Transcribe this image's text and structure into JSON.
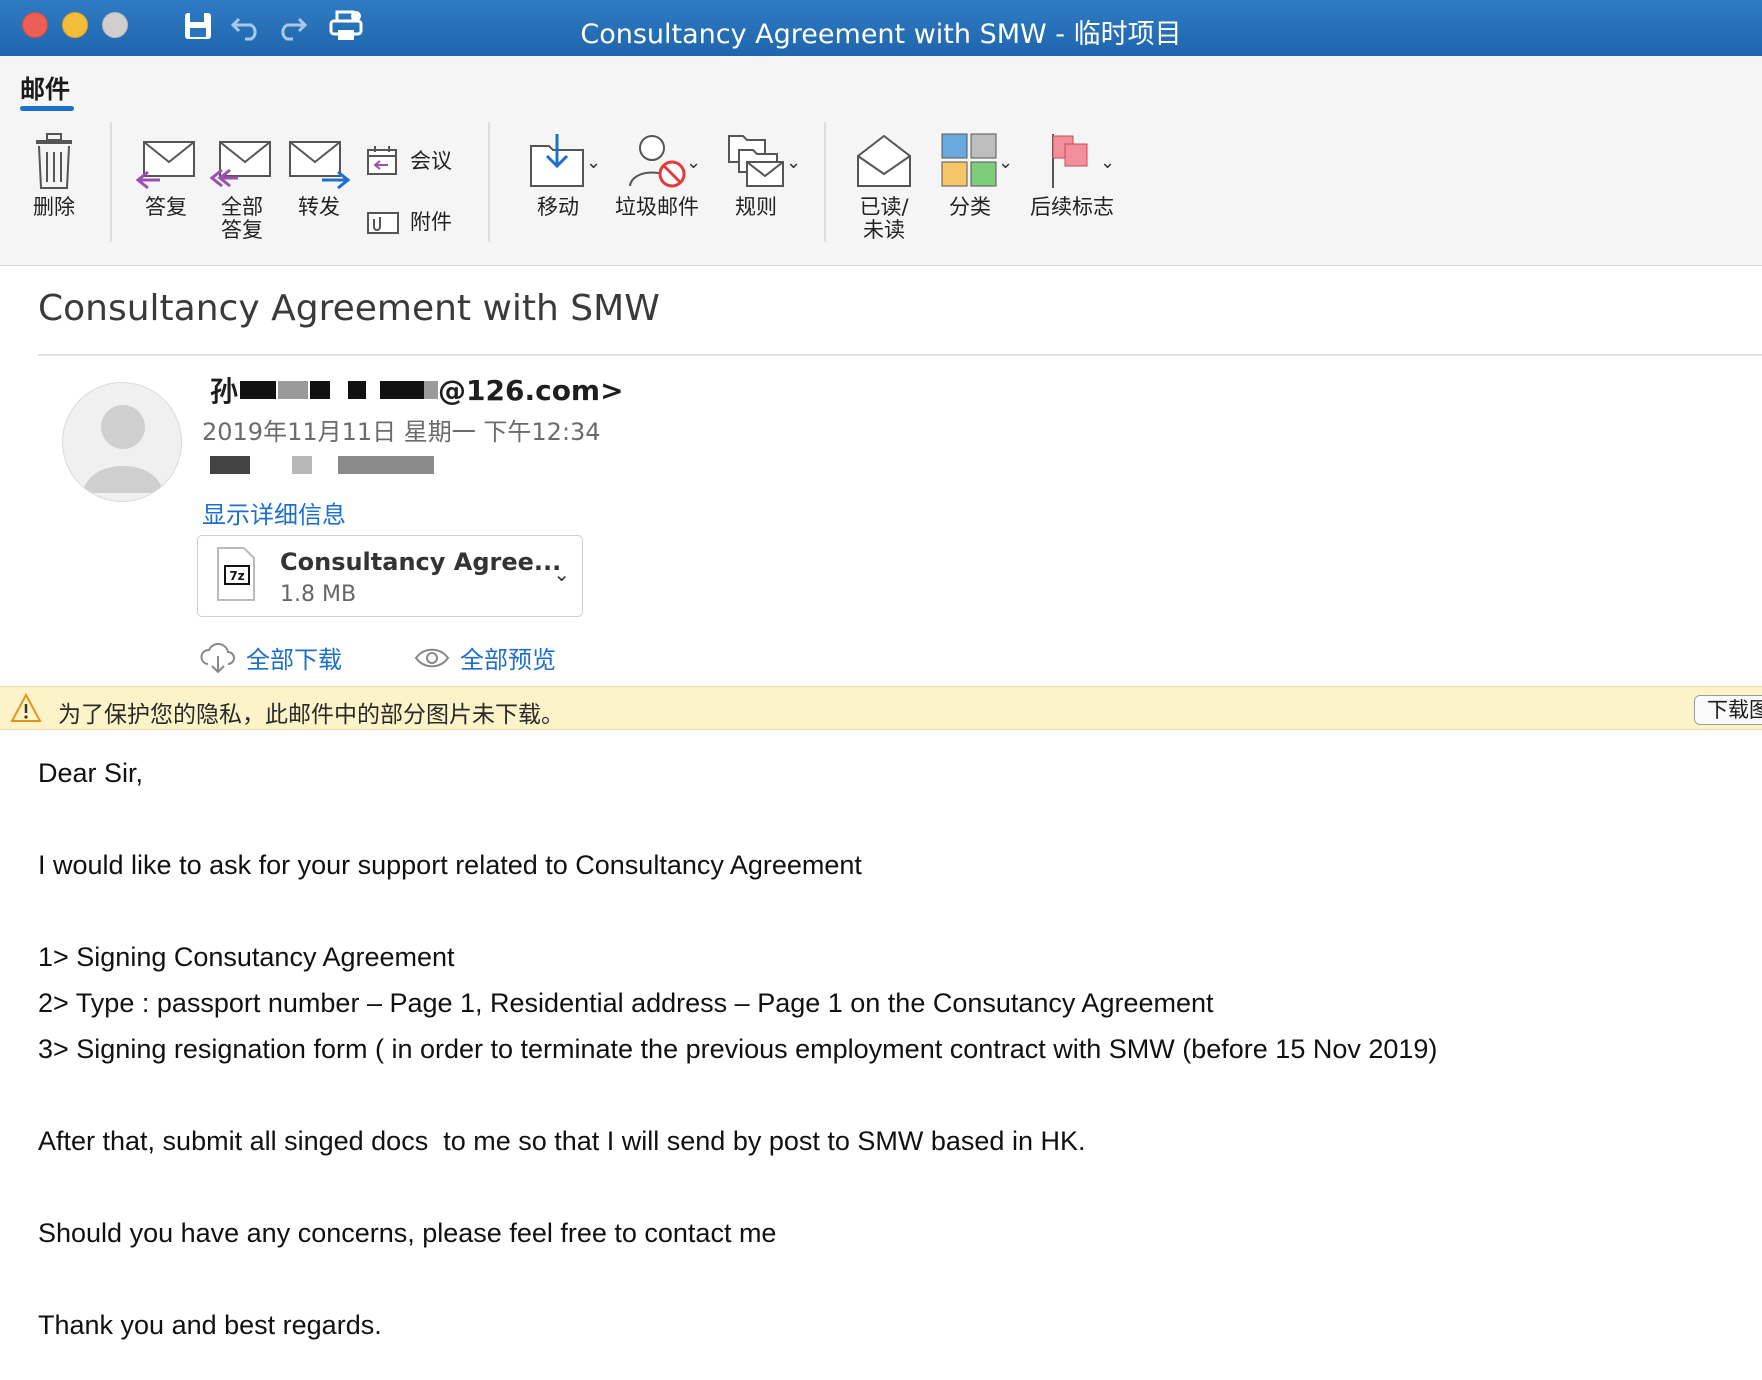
{
  "window": {
    "title": "Consultancy Agreement with SMW - 临时项目",
    "toolbar_icons": [
      "save-icon",
      "undo-icon",
      "redo-icon",
      "print-icon"
    ]
  },
  "ribbon": {
    "tab": "邮件",
    "delete": "删除",
    "reply": "答复",
    "reply_all_line1": "全部",
    "reply_all_line2": "答复",
    "forward": "转发",
    "meeting": "会议",
    "attachment": "附件",
    "move": "移动",
    "junk": "垃圾邮件",
    "rules": "规则",
    "read_unread_line1": "已读/",
    "read_unread_line2": "未读",
    "categorize": "分类",
    "follow_up": "后续标志"
  },
  "message": {
    "subject": "Consultancy Agreement with SMW",
    "sender_prefix": "孙",
    "sender_suffix": "@126.com>",
    "date": "2019年11月11日 星期一 下午12:34",
    "show_details": "显示详细信息",
    "attachment": {
      "name": "Consultancy Agree...",
      "size": "1.8 MB",
      "icon_label": "7z"
    },
    "download_all": "全部下载",
    "preview_all": "全部预览"
  },
  "privacy_bar": {
    "text": "为了保护您的隐私，此邮件中的部分图片未下载。",
    "button": "下载图"
  },
  "body": {
    "greeting": "Dear Sir,",
    "intro": "I would like to ask for your support related to Consultancy Agreement",
    "item1": "1> Signing Consutancy Agreement",
    "item2": "2> Type : passport number – Page 1, Residential address – Page 1 on the Consutancy Agreement",
    "item3": "3> Signing resignation form ( in order to terminate the previous employment contract with SMW (before 15 Nov 2019)",
    "after": "After that, submit all singed docs  to me so that I will send by post to SMW based in HK.",
    "concerns": "Should you have any concerns, please feel free to contact me",
    "closing": "Thank you and best regards."
  },
  "colors": {
    "titlebar": "#2a74bf",
    "link": "#1c6fcc",
    "privacy_bg": "#fdf3c9"
  }
}
